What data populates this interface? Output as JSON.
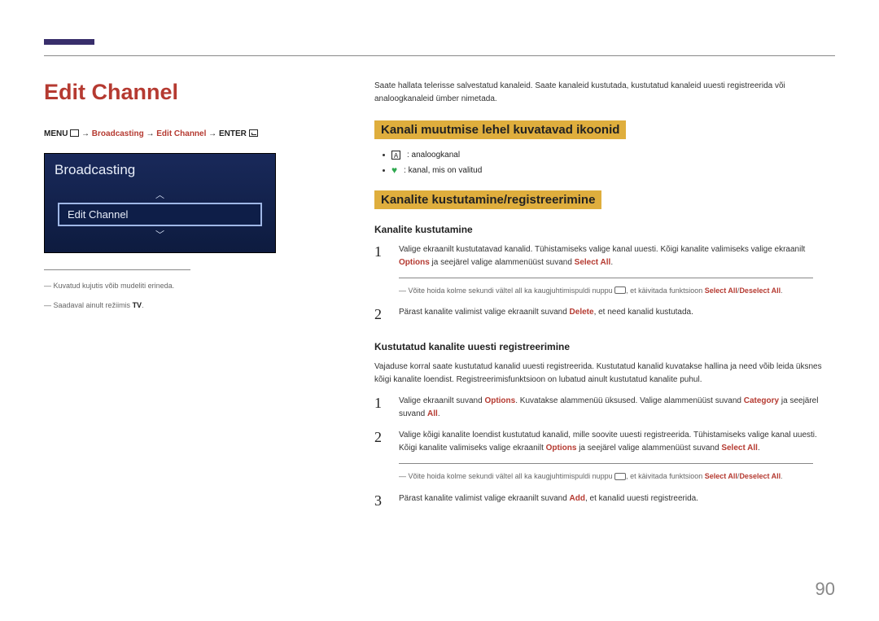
{
  "pageTitle": "Edit Channel",
  "breadcrumb": {
    "menu": "MENU",
    "arrow": " → ",
    "broadcasting": "Broadcasting",
    "editChannel": "Edit Channel",
    "enter": "ENTER"
  },
  "tvPanel": {
    "title": "Broadcasting",
    "selected": "Edit Channel",
    "chevronUp": "︿",
    "chevronDown": "﹀"
  },
  "footnotes": {
    "f1": "Kuvatud kujutis võib mudeliti erineda.",
    "f2_pre": "Saadaval ainult režiimis ",
    "f2_hl": "TV",
    "f2_post": "."
  },
  "intro": "Saate hallata telerisse salvestatud kanaleid. Saate kanaleid kustutada, kustutatud kanaleid uuesti registreerida või analoogkanaleid ümber nimetada.",
  "sections": {
    "icons": {
      "heading": "Kanali muutmise lehel kuvatavad ikoonid",
      "items": {
        "a": "A",
        "aText": ": analoogkanal",
        "heart": "♥",
        "heartText": ": kanal, mis on valitud"
      }
    },
    "deleteReg": {
      "heading": "Kanalite kustutamine/registreerimine",
      "delete": {
        "sub": "Kanalite kustutamine",
        "s1_a": "Valige ekraanilt kustutatavad kanalid. Tühistamiseks valige kanal uuesti. Kõigi kanalite valimiseks valige ekraanilt ",
        "s1_opt": "Options",
        "s1_b": " ja seejärel valige alammenüüst suvand ",
        "s1_sel": "Select All",
        "s1_c": ".",
        "note1_a": "Võite hoida kolme sekundi vältel all ka kaugjuhtimispuldi nuppu ",
        "note1_b": ", et käivitada funktsioon ",
        "note1_sel": "Select All",
        "note1_slash": "/",
        "note1_des": "Deselect All",
        "note1_c": ".",
        "s2_a": "Pärast kanalite valimist valige ekraanilt suvand ",
        "s2_del": "Delete",
        "s2_b": ", et need kanalid kustutada."
      },
      "rereg": {
        "sub": "Kustutatud kanalite uuesti registreerimine",
        "para": "Vajaduse korral saate kustutatud kanalid uuesti registreerida. Kustutatud kanalid kuvatakse hallina ja need võib leida üksnes kõigi kanalite loendist. Registreerimisfunktsioon on lubatud ainult kustutatud kanalite puhul.",
        "s1_a": "Valige ekraanilt suvand ",
        "s1_opt": "Options",
        "s1_b": ". Kuvatakse alammenüü üksused. Valige alammenüüst suvand ",
        "s1_cat": "Category",
        "s1_c": " ja seejärel suvand ",
        "s1_all": "All",
        "s1_d": ".",
        "s2_a": "Valige kõigi kanalite loendist kustutatud kanalid, mille soovite uuesti registreerida. Tühistamiseks valige kanal uuesti. Kõigi kanalite valimiseks valige ekraanilt ",
        "s2_opt": "Options",
        "s2_b": " ja seejärel valige alammenüüst suvand ",
        "s2_sel": "Select All",
        "s2_c": ".",
        "note2_a": "Võite hoida kolme sekundi vältel all ka kaugjuhtimispuldi nuppu ",
        "note2_b": ", et käivitada funktsioon ",
        "note2_sel": "Select All",
        "note2_slash": "/",
        "note2_des": "Deselect All",
        "note2_c": ".",
        "s3_a": "Pärast kanalite valimist valige ekraanilt suvand ",
        "s3_add": "Add",
        "s3_b": ", et kanalid uuesti registreerida."
      }
    }
  },
  "nums": {
    "n1": "1",
    "n2": "2",
    "n3": "3"
  },
  "pageNumber": "90"
}
